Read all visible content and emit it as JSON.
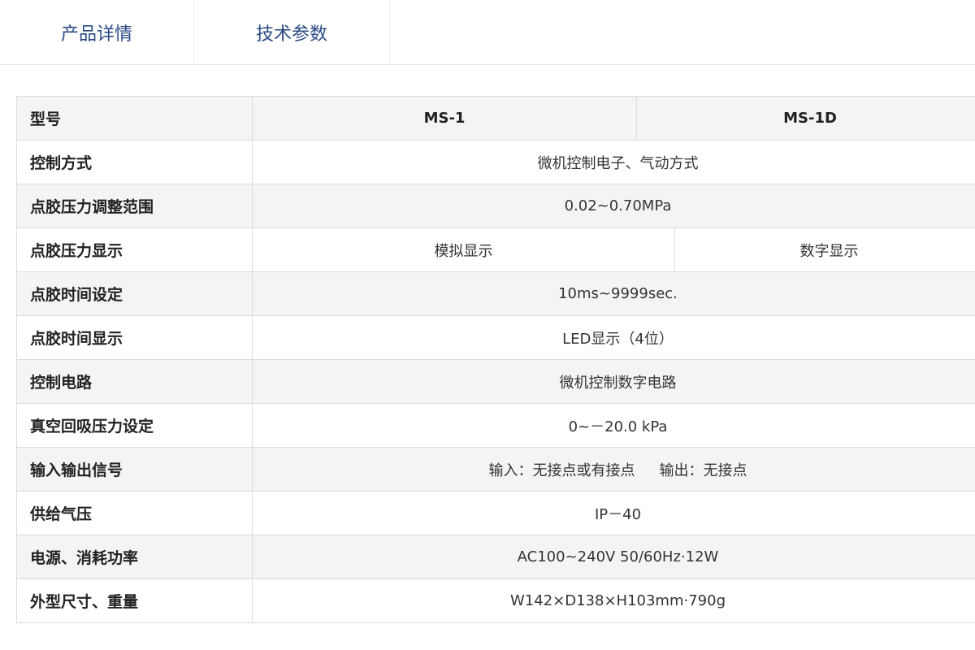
{
  "tabs": [
    {
      "label": "产品详情"
    },
    {
      "label": "技术参数"
    }
  ],
  "table": {
    "header": {
      "label": "型号",
      "models": [
        "MS-1",
        "MS-1D"
      ]
    },
    "rows": [
      {
        "label": "控制方式",
        "value": "微机控制电子、气动方式"
      },
      {
        "label": "点胶压力调整范围",
        "value": "0.02~0.70MPa"
      },
      {
        "label": "点胶压力显示",
        "values": [
          "模拟显示",
          "数字显示"
        ]
      },
      {
        "label": "点胶时间设定",
        "value": "10ms~9999sec."
      },
      {
        "label": "点胶时间显示",
        "value": "LED显示（4位）"
      },
      {
        "label": "控制电路",
        "value": "微机控制数字电路"
      },
      {
        "label": "真空回吸压力设定",
        "value": "0~－20.0 kPa"
      },
      {
        "label": "输入输出信号",
        "input": "输入：无接点或有接点",
        "output": "输出：无接点"
      },
      {
        "label": "供给气压",
        "value": "IP－40"
      },
      {
        "label": "电源、消耗功率",
        "value": "AC100~240V 50/60Hz·12W"
      },
      {
        "label": "外型尺寸、重量",
        "value": "W142×D138×H103mm·790g"
      }
    ]
  },
  "colors": {
    "tab_text": "#2a4a85",
    "border": "#dcdcdc",
    "row_alt": "#f4f4f4"
  }
}
